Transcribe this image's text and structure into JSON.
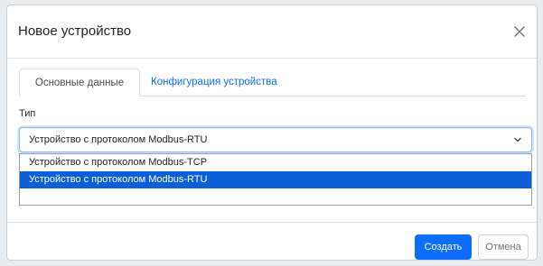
{
  "modal": {
    "title": "Новое устройство"
  },
  "tabs": [
    {
      "label": "Основные данные",
      "active": true
    },
    {
      "label": "Конфигурация устройства",
      "active": false
    }
  ],
  "form": {
    "type_label": "Тип",
    "type_selected": "Устройство с протоколом Modbus-RTU",
    "type_options": [
      "Устройство с протоколом Modbus-TCP",
      "Устройство с протоколом Modbus-RTU"
    ],
    "highlighted_option_index": 1
  },
  "footer": {
    "create_label": "Создать",
    "cancel_label": "Отмена"
  },
  "icons": {
    "close": "close-icon",
    "select_arrow": "chevron-down-icon"
  },
  "colors": {
    "primary": "#0d6efd",
    "highlight": "#0a5ed7",
    "link": "#0d6efd"
  }
}
